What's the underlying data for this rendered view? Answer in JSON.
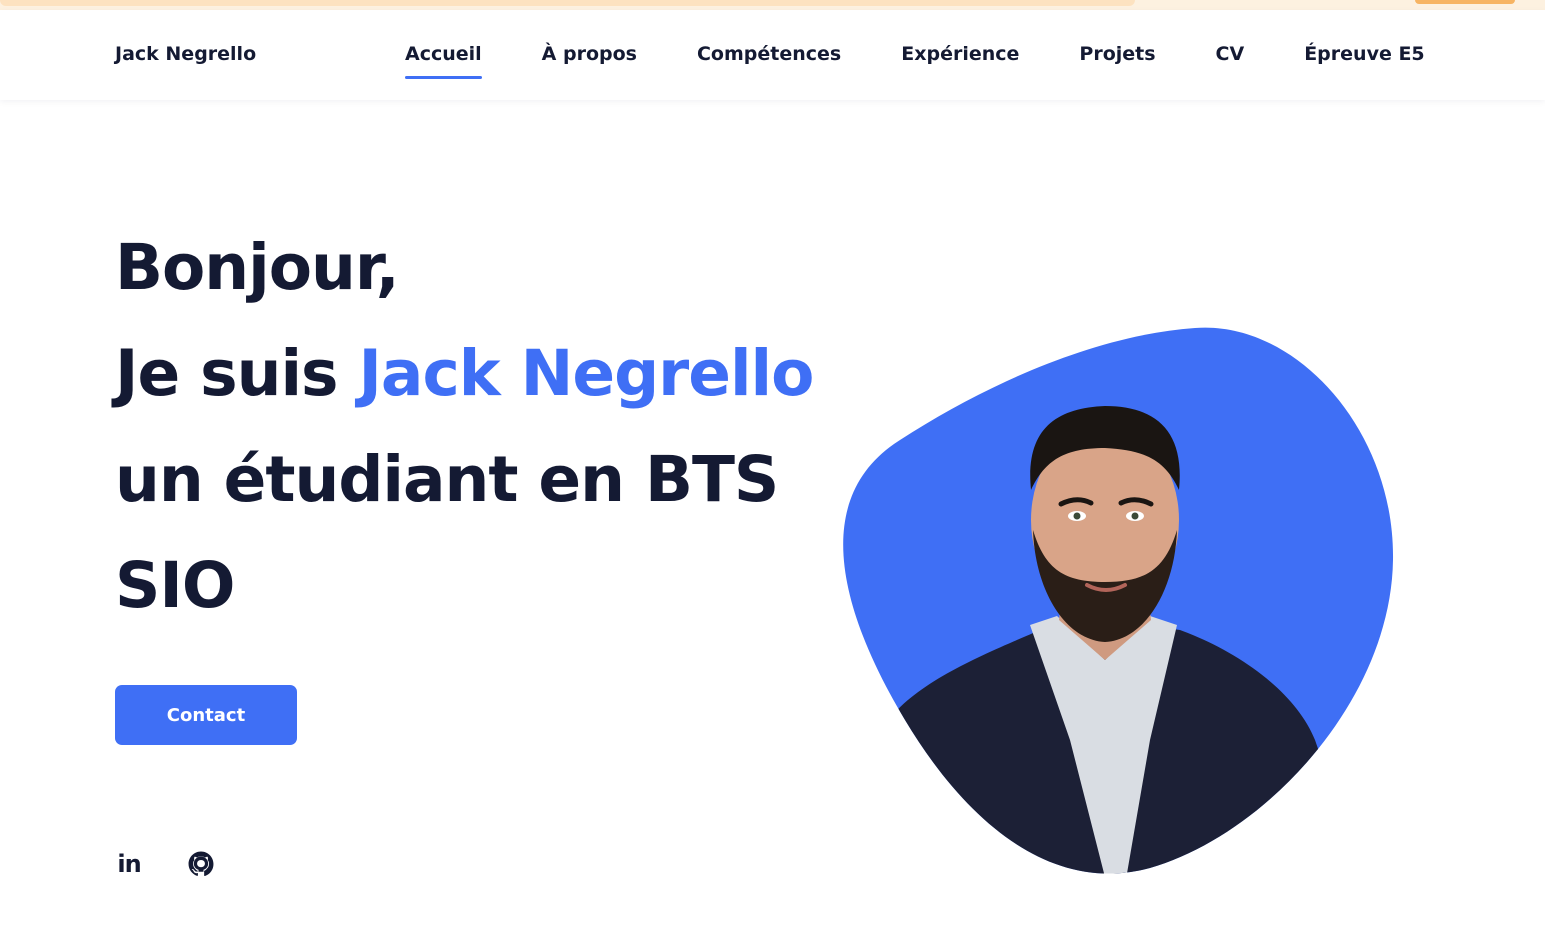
{
  "brand": "Jack Negrello",
  "nav": [
    {
      "label": "Accueil",
      "active": true
    },
    {
      "label": "À propos",
      "active": false
    },
    {
      "label": "Compétences",
      "active": false
    },
    {
      "label": "Expérience",
      "active": false
    },
    {
      "label": "Projets",
      "active": false
    },
    {
      "label": "CV",
      "active": false
    },
    {
      "label": "Épreuve E5",
      "active": false
    }
  ],
  "hero": {
    "greeting": "Bonjour,",
    "intro": "Je suis ",
    "name": "Jack Negrello",
    "role_line1": "un étudiant en BTS",
    "role_line2": "SIO"
  },
  "contact_button": "Contact",
  "social": [
    {
      "icon": "linkedin-icon"
    },
    {
      "icon": "github-icon"
    }
  ],
  "colors": {
    "accent": "#3f6ff5",
    "text": "#141a33",
    "background": "#ffffff"
  }
}
